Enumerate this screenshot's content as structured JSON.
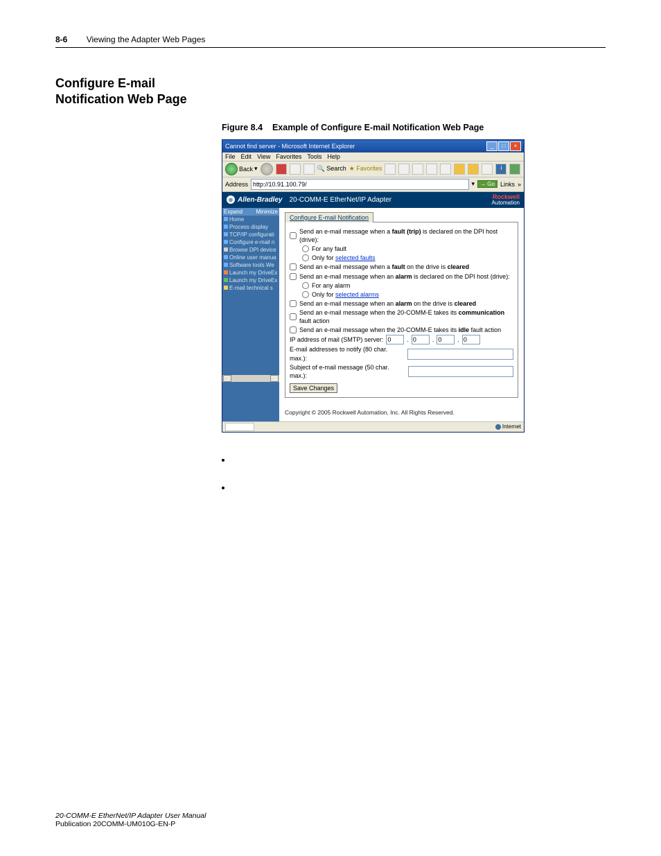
{
  "header": {
    "page_number": "8-6",
    "running_title": "Viewing the Adapter Web Pages"
  },
  "section_title_line1": "Configure E-mail",
  "section_title_line2": "Notification Web Page",
  "figure": {
    "label": "Figure 8.4",
    "caption": "Example of Configure E-mail Notification Web Page"
  },
  "ie": {
    "title": "Cannot find server - Microsoft Internet Explorer",
    "menus": [
      "File",
      "Edit",
      "View",
      "Favorites",
      "Tools",
      "Help"
    ],
    "back": "Back",
    "search": "Search",
    "favorites": "Favorites",
    "addr_label": "Address",
    "address_value": "http://10.91.100.79/",
    "go": "Go",
    "links": "Links",
    "status_zone": "Internet"
  },
  "ab": {
    "brand": "Allen-Bradley",
    "product": "20-COMM-E EtherNet/IP Adapter",
    "rockwell1": "Rockwell",
    "rockwell2": "Automation",
    "expand": "Expand",
    "minimize": "Minimize",
    "nav": [
      {
        "label": "Home",
        "color": "#6ab0ff"
      },
      {
        "label": "Process display",
        "color": "#6ab0ff"
      },
      {
        "label": "TCP/IP configurati",
        "color": "#6ab0ff"
      },
      {
        "label": "Configure e-mail n",
        "color": "#6ab0ff"
      },
      {
        "label": "Browse DPI device",
        "color": "#d0d0d0"
      },
      {
        "label": "Online user manua",
        "color": "#6ab0ff"
      },
      {
        "label": "Software tools We",
        "color": "#6ab0ff"
      },
      {
        "label": "Launch my DriveEx",
        "color": "#ff8040"
      },
      {
        "label": "Launch my DriveEx",
        "color": "#60c060"
      },
      {
        "label": "E-mail technical s",
        "color": "#f0d060"
      }
    ],
    "tab": "Configure E-mail Notification",
    "cb_fault_trip_prefix": "Send an e-mail message when a ",
    "cb_fault_trip_bold": "fault (trip)",
    "cb_fault_trip_suffix": " is declared on the DPI host (drive):",
    "rb_any_fault": "For any fault",
    "rb_only_faults_prefix": "Only for ",
    "rb_only_faults_link": "selected faults",
    "cb_fault_cleared_prefix": "Send an e-mail message when a ",
    "cb_fault_cleared_bold": "fault",
    "cb_fault_cleared_mid": " on the drive is ",
    "cb_fault_cleared_bold2": "cleared",
    "cb_alarm_declared_prefix": "Send an e-mail message when an ",
    "cb_alarm_declared_bold": "alarm",
    "cb_alarm_declared_suffix": " is declared on the DPI host (drive):",
    "rb_any_alarm": "For any alarm",
    "rb_only_alarms_prefix": "Only for ",
    "rb_only_alarms_link": "selected alarms",
    "cb_alarm_cleared_prefix": "Send an e-mail message when an ",
    "cb_alarm_cleared_bold": "alarm",
    "cb_alarm_cleared_mid": " on the drive is ",
    "cb_alarm_cleared_bold2": "cleared",
    "cb_comm_fault_prefix": "Send an e-mail message when the 20-COMM-E takes its ",
    "cb_comm_fault_bold": "communication",
    "cb_comm_fault_suffix": " fault action",
    "cb_idle_fault_prefix": "Send an e-mail message when the 20-COMM-E takes its ",
    "cb_idle_fault_bold": "idle",
    "cb_idle_fault_suffix": " fault action",
    "ip_label": "IP address of mail (SMTP) server:",
    "ip": [
      "0",
      "0",
      "0",
      "0"
    ],
    "email_addr_label": "E-mail addresses to notify (80 char. max.):",
    "subject_label": "Subject of e-mail message (50 char. max.):",
    "save": "Save Changes",
    "copyright": "Copyright © 2005 Rockwell Automation, Inc. All Rights Reserved."
  },
  "footer": {
    "line1": "20-COMM-E EtherNet/IP Adapter User Manual",
    "line2": "Publication 20COMM-UM010G-EN-P"
  }
}
